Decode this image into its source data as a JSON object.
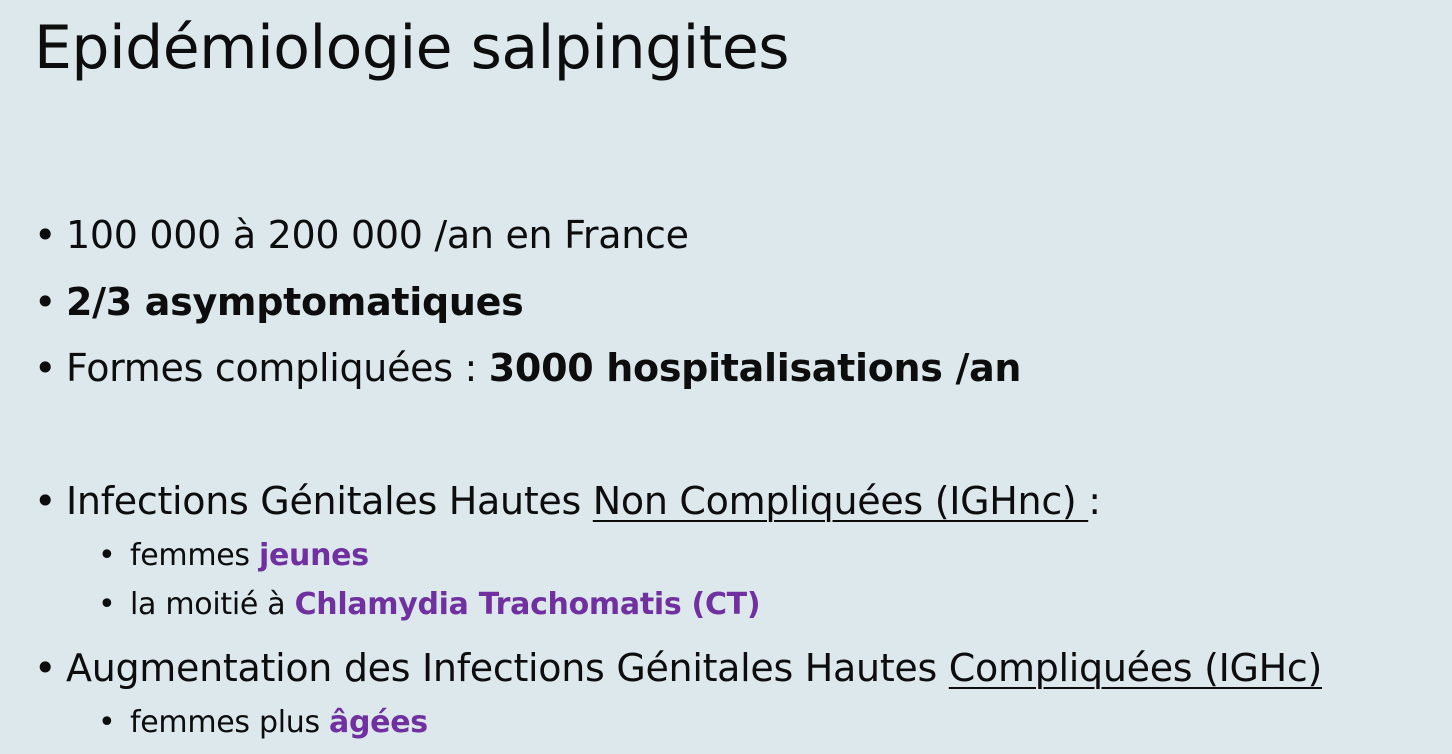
{
  "slide": {
    "title": "Epidémiologie salpingites",
    "bullet_char": "•",
    "b1": "100 000 à 200 000 /an en France",
    "b2": "2/3 asymptomatiques",
    "b3_prefix": "Formes compliquées : ",
    "b3_bold": "3000 hospitalisations /an",
    "b4_prefix": "Infections Génitales Hautes ",
    "b4_underline": "Non Compliquées (IGHnc) ",
    "b4_suffix": ":",
    "b4_sub1_prefix": "femmes ",
    "b4_sub1_highlight": "jeunes",
    "b4_sub2_prefix": "la moitié à ",
    "b4_sub2_highlight": "Chlamydia Trachomatis (CT)",
    "b5_prefix": "Augmentation  des Infections Génitales Hautes ",
    "b5_underline": "Compliquées (IGHc)",
    "b5_sub1_prefix": "femmes plus ",
    "b5_sub1_highlight": "âgées"
  },
  "colors": {
    "background": "#dce8ec",
    "text": "#0d0d0d",
    "highlight": "#7030a0"
  }
}
